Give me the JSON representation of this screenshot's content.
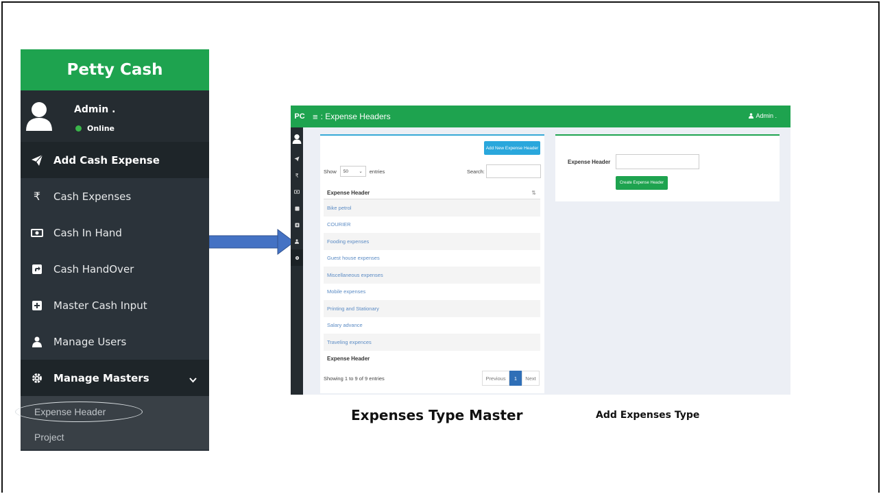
{
  "sidebar": {
    "brand": "Petty Cash",
    "user_name": "Admin .",
    "user_status": "Online",
    "items": [
      {
        "label": "Add Cash Expense",
        "icon": "paper-plane-icon"
      },
      {
        "label": "Cash Expenses",
        "icon": "rupee-icon"
      },
      {
        "label": "Cash In Hand",
        "icon": "money-bill-icon"
      },
      {
        "label": "Cash HandOver",
        "icon": "share-square-icon"
      },
      {
        "label": "Master Cash Input",
        "icon": "plus-square-icon"
      },
      {
        "label": "Manage Users",
        "icon": "user-icon"
      },
      {
        "label": "Manage Masters",
        "icon": "gear-icon"
      }
    ],
    "sub_items": [
      "Expense Header",
      "Project"
    ]
  },
  "app": {
    "brand": "PC",
    "title": ": Expense Headers",
    "admin": "Admin .",
    "add_button": "Add New Expense Header",
    "show_label": "Show",
    "show_value": "50",
    "entries_label": "entries",
    "search_label": "Search:",
    "column_header": "Expense Header",
    "rows": [
      "Bike petrol",
      "COURIER",
      "Fooding expenses",
      "Guest house expenses",
      "Miscellaneous expenses",
      "Mobile expenses",
      "Printing and Stationary",
      "Salary advance",
      "Traveling expences"
    ],
    "column_footer": "Expense Header",
    "showing": "Showing 1 to 9 of 9 entries",
    "pager": {
      "prev": "Previous",
      "page": "1",
      "next": "Next"
    },
    "form_label": "Expense Header",
    "create_button": "Create Expense Header"
  },
  "captions": {
    "left": "Expenses Type Master",
    "right": "Add Expenses Type"
  },
  "colors": {
    "brand_green": "#1ea34f",
    "sidebar_dark": "#2b333a",
    "accent_blue": "#2aa7dc",
    "arrow_blue": "#4472c4"
  }
}
